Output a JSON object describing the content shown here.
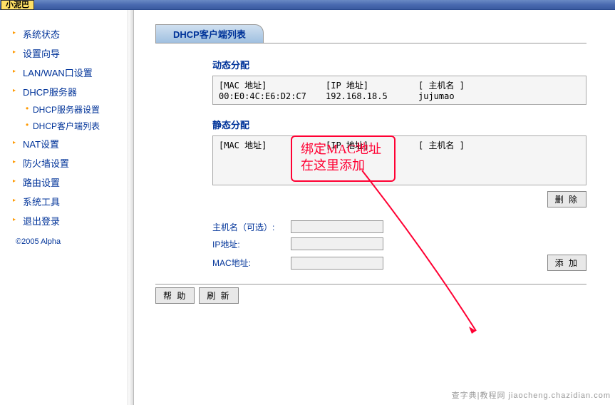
{
  "titlebar": "小泥巴",
  "nav": [
    {
      "label": "系统状态",
      "sub": []
    },
    {
      "label": "设置向导",
      "sub": []
    },
    {
      "label": "LAN/WAN口设置",
      "sub": []
    },
    {
      "label": "DHCP服务器",
      "sub": [
        {
          "label": "DHCP服务器设置"
        },
        {
          "label": "DHCP客户端列表"
        }
      ]
    },
    {
      "label": "NAT设置",
      "sub": []
    },
    {
      "label": "防火墙设置",
      "sub": []
    },
    {
      "label": "路由设置",
      "sub": []
    },
    {
      "label": "系统工具",
      "sub": []
    },
    {
      "label": "退出登录",
      "sub": []
    }
  ],
  "copyright": "©2005 Alpha",
  "page_title": "DHCP客户端列表",
  "dynamic": {
    "title": "动态分配",
    "headers": {
      "mac": "[MAC 地址]",
      "ip": "[IP 地址]",
      "host": "[ 主机名 ]"
    },
    "rows": [
      {
        "mac": "00:E0:4C:E6:D2:C7",
        "ip": "192.168.18.5",
        "host": "jujumao"
      }
    ]
  },
  "static": {
    "title": "静态分配",
    "headers": {
      "mac": "[MAC 地址]",
      "ip": "[IP 地址]",
      "host": "[ 主机名 ]"
    },
    "delete_btn": "删 除"
  },
  "form": {
    "hostname_label": "主机名（可选）:",
    "ip_label": "IP地址:",
    "mac_label": "MAC地址:",
    "add_btn": "添 加",
    "hostname_val": "",
    "ip_val": "",
    "mac_val": ""
  },
  "buttons": {
    "help": "帮 助",
    "refresh": "刷 新"
  },
  "annotation": {
    "line1": "绑定MAC地址",
    "line2": "在这里添加"
  },
  "watermark": "查字典|教程网 jiaocheng.chazidian.com"
}
